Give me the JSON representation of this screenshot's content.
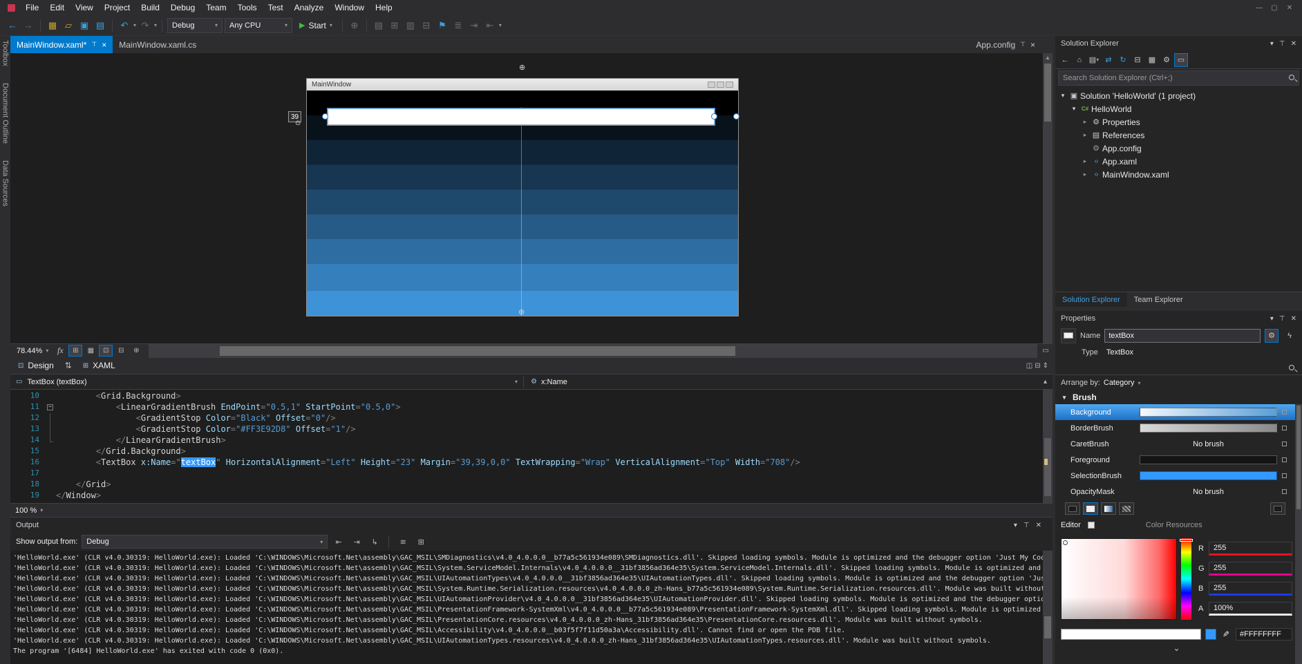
{
  "menu": {
    "items": [
      "File",
      "Edit",
      "View",
      "Project",
      "Build",
      "Debug",
      "Team",
      "Tools",
      "Test",
      "Analyze",
      "Window",
      "Help"
    ]
  },
  "toolbar": {
    "configuration": "Debug",
    "platform": "Any CPU",
    "start": "Start"
  },
  "left_strip": {
    "items": [
      "Toolbox",
      "Document Outline",
      "Data Sources"
    ]
  },
  "tabs": {
    "doc1": "MainWindow.xaml*",
    "doc2": "MainWindow.xaml.cs",
    "preview": "App.config"
  },
  "designer": {
    "window_title": "MainWindow",
    "margin": "39",
    "zoom": "78.44%",
    "gradient_top": "#000000",
    "gradient_bottom": "#3E92D8"
  },
  "panes": {
    "design": "Design",
    "xaml": "XAML"
  },
  "breadcrumb": {
    "control": "TextBox (textBox)",
    "property": "x:Name"
  },
  "xaml": {
    "zoom": "100 %",
    "lines": [
      {
        "num": 10,
        "outline": "",
        "tokens": [
          [
            "pl",
            "        <"
          ],
          [
            "tg",
            "Grid.Background"
          ],
          [
            "pl",
            ">"
          ]
        ]
      },
      {
        "num": 11,
        "outline": "minus",
        "tokens": [
          [
            "pl",
            "            <"
          ],
          [
            "tg",
            "LinearGradientBrush"
          ],
          [
            "pl",
            " "
          ],
          [
            "at",
            "EndPoint"
          ],
          [
            "pl",
            "="
          ],
          [
            "vl",
            "\"0.5,1\""
          ],
          [
            "pl",
            " "
          ],
          [
            "at",
            "StartPoint"
          ],
          [
            "pl",
            "="
          ],
          [
            "vl",
            "\"0.5,0\""
          ],
          [
            "pl",
            ">"
          ]
        ]
      },
      {
        "num": 12,
        "outline": "g",
        "tokens": [
          [
            "pl",
            "                <"
          ],
          [
            "tg",
            "GradientStop"
          ],
          [
            "pl",
            " "
          ],
          [
            "at",
            "Color"
          ],
          [
            "pl",
            "="
          ],
          [
            "vl",
            "\"Black\""
          ],
          [
            "pl",
            " "
          ],
          [
            "at",
            "Offset"
          ],
          [
            "pl",
            "="
          ],
          [
            "vl",
            "\"0\""
          ],
          [
            "pl",
            "/>"
          ]
        ]
      },
      {
        "num": 13,
        "outline": "g",
        "tokens": [
          [
            "pl",
            "                <"
          ],
          [
            "tg",
            "GradientStop"
          ],
          [
            "pl",
            " "
          ],
          [
            "at",
            "Color"
          ],
          [
            "pl",
            "="
          ],
          [
            "vl",
            "\"#FF3E92D8\""
          ],
          [
            "pl",
            " "
          ],
          [
            "at",
            "Offset"
          ],
          [
            "pl",
            "="
          ],
          [
            "vl",
            "\"1\""
          ],
          [
            "pl",
            "/>"
          ]
        ]
      },
      {
        "num": 14,
        "outline": "ge",
        "tokens": [
          [
            "pl",
            "            </"
          ],
          [
            "tg",
            "LinearGradientBrush"
          ],
          [
            "pl",
            ">"
          ]
        ]
      },
      {
        "num": 15,
        "outline": "",
        "tokens": [
          [
            "pl",
            "        </"
          ],
          [
            "tg",
            "Grid.Background"
          ],
          [
            "pl",
            ">"
          ]
        ]
      },
      {
        "num": 16,
        "outline": "",
        "tokens": [
          [
            "pl",
            "        <"
          ],
          [
            "tg",
            "TextBox"
          ],
          [
            "pl",
            " "
          ],
          [
            "at",
            "x:Name"
          ],
          [
            "pl",
            "="
          ],
          [
            "vl",
            "\""
          ],
          [
            "sel",
            "textBox"
          ],
          [
            "vl",
            "\""
          ],
          [
            "pl",
            " "
          ],
          [
            "at",
            "HorizontalAlignment"
          ],
          [
            "pl",
            "="
          ],
          [
            "vl",
            "\"Left\""
          ],
          [
            "pl",
            " "
          ],
          [
            "at",
            "Height"
          ],
          [
            "pl",
            "="
          ],
          [
            "vl",
            "\"23\""
          ],
          [
            "pl",
            " "
          ],
          [
            "at",
            "Margin"
          ],
          [
            "pl",
            "="
          ],
          [
            "vl",
            "\"39,39,0,0\""
          ],
          [
            "pl",
            " "
          ],
          [
            "at",
            "TextWrapping"
          ],
          [
            "pl",
            "="
          ],
          [
            "vl",
            "\"Wrap\""
          ],
          [
            "pl",
            " "
          ],
          [
            "at",
            "VerticalAlignment"
          ],
          [
            "pl",
            "="
          ],
          [
            "vl",
            "\"Top\""
          ],
          [
            "pl",
            " "
          ],
          [
            "at",
            "Width"
          ],
          [
            "pl",
            "="
          ],
          [
            "vl",
            "\"708\""
          ],
          [
            "pl",
            "/>"
          ]
        ]
      },
      {
        "num": 17,
        "outline": "",
        "tokens": []
      },
      {
        "num": 18,
        "outline": "",
        "tokens": [
          [
            "pl",
            "    </"
          ],
          [
            "tg",
            "Grid"
          ],
          [
            "pl",
            ">"
          ]
        ]
      },
      {
        "num": 19,
        "outline": "",
        "tokens": [
          [
            "pl",
            "</"
          ],
          [
            "tg",
            "Window"
          ],
          [
            "pl",
            ">"
          ]
        ]
      }
    ]
  },
  "output": {
    "title": "Output",
    "from_label": "Show output from:",
    "source": "Debug",
    "lines": [
      "'HelloWorld.exe' (CLR v4.0.30319: HelloWorld.exe): Loaded 'C:\\WINDOWS\\Microsoft.Net\\assembly\\GAC_MSIL\\SMDiagnostics\\v4.0_4.0.0.0__b77a5c561934e089\\SMDiagnostics.dll'. Skipped loading symbols. Module is optimized and the debugger option 'Just My Code' is enabled.",
      "'HelloWorld.exe' (CLR v4.0.30319: HelloWorld.exe): Loaded 'C:\\WINDOWS\\Microsoft.Net\\assembly\\GAC_MSIL\\System.ServiceModel.Internals\\v4.0_4.0.0.0__31bf3856ad364e35\\System.ServiceModel.Internals.dll'. Skipped loading symbols. Module is optimized and the debugger option 'Just My Code' is enabled.",
      "'HelloWorld.exe' (CLR v4.0.30319: HelloWorld.exe): Loaded 'C:\\WINDOWS\\Microsoft.Net\\assembly\\GAC_MSIL\\UIAutomationTypes\\v4.0_4.0.0.0__31bf3856ad364e35\\UIAutomationTypes.dll'. Skipped loading symbols. Module is optimized and the debugger option 'Just My Code' is enabled.",
      "'HelloWorld.exe' (CLR v4.0.30319: HelloWorld.exe): Loaded 'C:\\WINDOWS\\Microsoft.Net\\assembly\\GAC_MSIL\\System.Runtime.Serialization.resources\\v4.0_4.0.0.0_zh-Hans_b77a5c561934e089\\System.Runtime.Serialization.resources.dll'. Module was built without symbols.",
      "'HelloWorld.exe' (CLR v4.0.30319: HelloWorld.exe): Loaded 'C:\\WINDOWS\\Microsoft.Net\\assembly\\GAC_MSIL\\UIAutomationProvider\\v4.0_4.0.0.0__31bf3856ad364e35\\UIAutomationProvider.dll'. Skipped loading symbols. Module is optimized and the debugger option 'Just My Code' is enabled.",
      "'HelloWorld.exe' (CLR v4.0.30319: HelloWorld.exe): Loaded 'C:\\WINDOWS\\Microsoft.Net\\assembly\\GAC_MSIL\\PresentationFramework-SystemXml\\v4.0_4.0.0.0__b77a5c561934e089\\PresentationFramework-SystemXml.dll'. Skipped loading symbols. Module is optimized and the debugger option 'Just My Code' is enabled.",
      "'HelloWorld.exe' (CLR v4.0.30319: HelloWorld.exe): Loaded 'C:\\WINDOWS\\Microsoft.Net\\assembly\\GAC_MSIL\\PresentationCore.resources\\v4.0_4.0.0.0_zh-Hans_31bf3856ad364e35\\PresentationCore.resources.dll'. Module was built without symbols.",
      "'HelloWorld.exe' (CLR v4.0.30319: HelloWorld.exe): Loaded 'C:\\WINDOWS\\Microsoft.Net\\assembly\\GAC_MSIL\\Accessibility\\v4.0_4.0.0.0__b03f5f7f11d50a3a\\Accessibility.dll'. Cannot find or open the PDB file.",
      "'HelloWorld.exe' (CLR v4.0.30319: HelloWorld.exe): Loaded 'C:\\WINDOWS\\Microsoft.Net\\assembly\\GAC_MSIL\\UIAutomationTypes.resources\\v4.0_4.0.0.0_zh-Hans_31bf3856ad364e35\\UIAutomationTypes.resources.dll'. Module was built without symbols.",
      "The program '[6484] HelloWorld.exe' has exited with code 0 (0x0)."
    ]
  },
  "solution_explorer": {
    "title": "Solution Explorer",
    "search_placeholder": "Search Solution Explorer (Ctrl+;)",
    "tree": [
      {
        "label": "Solution 'HelloWorld' (1 project)",
        "indent": 0,
        "icon": "solution",
        "expander": "expanded"
      },
      {
        "label": "HelloWorld",
        "indent": 1,
        "icon": "csproject",
        "expander": "expanded"
      },
      {
        "label": "Properties",
        "indent": 2,
        "icon": "properties",
        "expander": "collapsed"
      },
      {
        "label": "References",
        "indent": 2,
        "icon": "references",
        "expander": "collapsed"
      },
      {
        "label": "App.config",
        "indent": 2,
        "icon": "config",
        "expander": "none"
      },
      {
        "label": "App.xaml",
        "indent": 2,
        "icon": "xaml",
        "expander": "collapsed"
      },
      {
        "label": "MainWindow.xaml",
        "indent": 2,
        "icon": "xaml",
        "expander": "collapsed"
      }
    ],
    "tabs": [
      "Solution Explorer",
      "Team Explorer"
    ]
  },
  "properties": {
    "title": "Properties",
    "name_label": "Name",
    "name_value": "textBox",
    "type_label": "Type",
    "type_value": "TextBox",
    "arrange_label": "Arrange by:",
    "arrange_value": "Category",
    "category": "Brush",
    "rows": [
      {
        "label": "Background",
        "kind": "gradient-blue",
        "selected": true
      },
      {
        "label": "BorderBrush",
        "kind": "gradient-gray",
        "selected": false
      },
      {
        "label": "CaretBrush",
        "kind": "none",
        "value": "No brush",
        "selected": false
      },
      {
        "label": "Foreground",
        "kind": "dark",
        "selected": false
      },
      {
        "label": "SelectionBrush",
        "kind": "solid",
        "selected": false
      },
      {
        "label": "OpacityMask",
        "kind": "none",
        "value": "No brush",
        "selected": false
      }
    ],
    "tabs": {
      "editor": "Editor",
      "resources": "Color Resources"
    },
    "channels": [
      {
        "label": "R",
        "value": "255",
        "underline": "#E81123"
      },
      {
        "label": "G",
        "value": "255",
        "underline": "#E3008C"
      },
      {
        "label": "B",
        "value": "255",
        "underline": "#1B3BE8"
      },
      {
        "label": "A",
        "value": "100%",
        "underline": "#E8E8E8"
      }
    ],
    "hex": "#FFFFFFFF"
  }
}
